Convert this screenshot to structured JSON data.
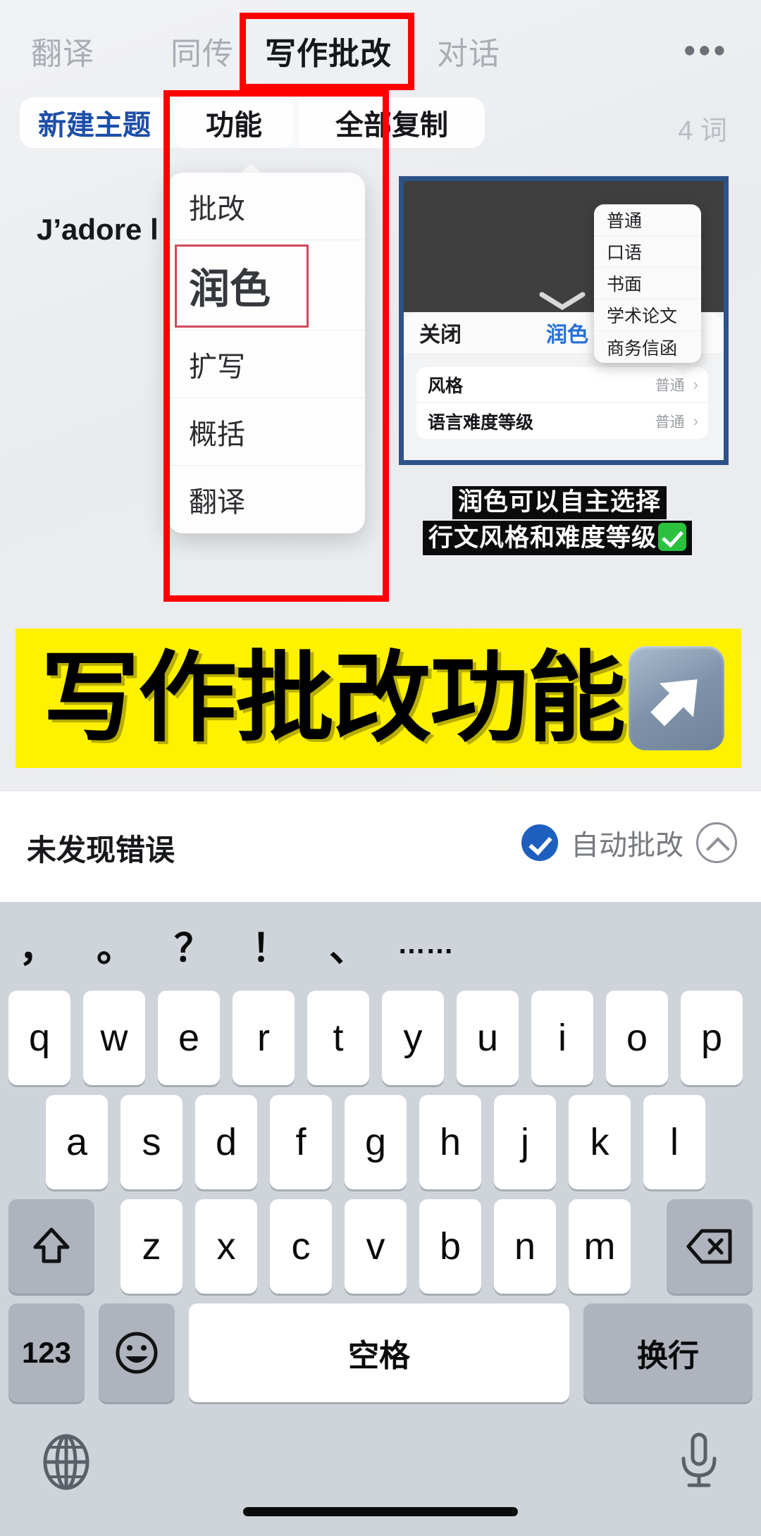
{
  "app": {
    "tabs": [
      {
        "label": "翻译",
        "active": false
      },
      {
        "label": "同传",
        "active": false
      },
      {
        "label": "写作批改",
        "active": true
      },
      {
        "label": "对话",
        "active": false
      }
    ],
    "more_icon": "•••",
    "pills": [
      {
        "label": "新建主题"
      },
      {
        "label": "功能"
      },
      {
        "label": "全部复制"
      }
    ],
    "word_count": "4 词",
    "editor_text": "J’adore l"
  },
  "function_menu": {
    "items": [
      {
        "label": "批改",
        "highlighted": false
      },
      {
        "label": "润色",
        "highlighted": true
      },
      {
        "label": "扩写",
        "highlighted": false
      },
      {
        "label": "概括",
        "highlighted": false
      },
      {
        "label": "翻译",
        "highlighted": false
      }
    ]
  },
  "inset": {
    "close_label": "关闭",
    "title": "润色",
    "rows": [
      {
        "label": "风格",
        "value": "普通",
        "chevron": "›"
      },
      {
        "label": "语言难度等级",
        "value": "普通",
        "chevron": "›"
      }
    ],
    "style_options": [
      "普通",
      "口语",
      "书面",
      "学术论文",
      "商务信函"
    ]
  },
  "caption": {
    "line1": "润色可以自主选择",
    "line2": "行文风格和难度等级"
  },
  "banner": {
    "text": "写作批改功能",
    "arrow_icon": "arrow-up-right-icon"
  },
  "status": {
    "message": "未发现错误",
    "auto_label": "自动批改",
    "check_icon": "check-circle-icon",
    "collapse_icon": "chevron-up-icon"
  },
  "keyboard": {
    "punctuation": [
      "，",
      "。",
      "？",
      "！",
      "、",
      "……"
    ],
    "row1": [
      "q",
      "w",
      "e",
      "r",
      "t",
      "y",
      "u",
      "i",
      "o",
      "p"
    ],
    "row2": [
      "a",
      "s",
      "d",
      "f",
      "g",
      "h",
      "j",
      "k",
      "l"
    ],
    "row3": [
      "z",
      "x",
      "c",
      "v",
      "b",
      "n",
      "m"
    ],
    "shift_icon": "shift-up-icon",
    "backspace_icon": "backspace-icon",
    "numbers_label": "123",
    "emoji_icon": "emoji-smiley-icon",
    "space_label": "空格",
    "return_label": "换行",
    "globe_icon": "globe-icon",
    "mic_icon": "microphone-icon"
  },
  "colors": {
    "accent_blue": "#1d5fbf",
    "annotation_red": "#ff0000",
    "banner_yellow": "#fff200",
    "inset_border": "#2d5287",
    "check_green": "#2bc13f"
  }
}
